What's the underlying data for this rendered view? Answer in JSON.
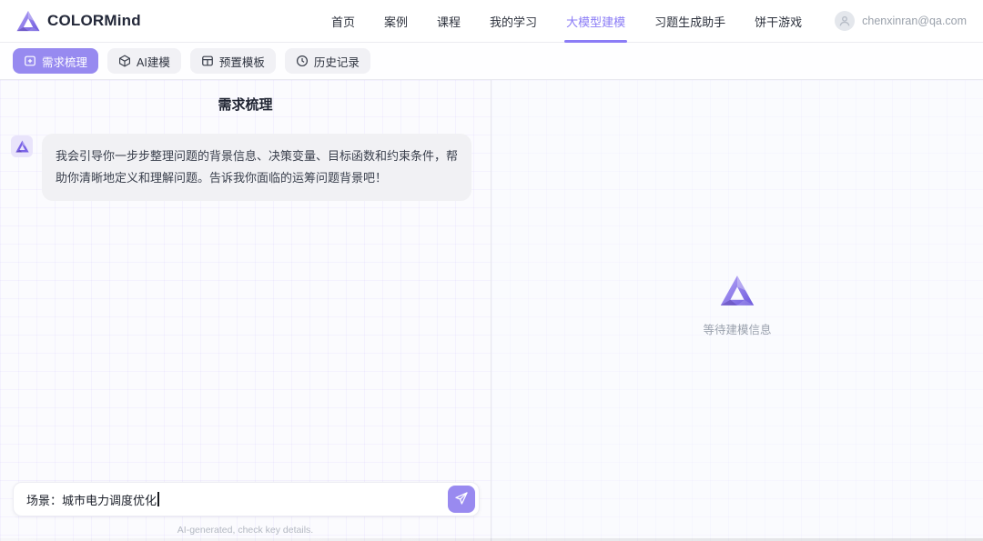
{
  "header": {
    "brand": "COLORMind",
    "nav": [
      {
        "label": "首页",
        "active": false
      },
      {
        "label": "案例",
        "active": false
      },
      {
        "label": "课程",
        "active": false
      },
      {
        "label": "我的学习",
        "active": false
      },
      {
        "label": "大模型建模",
        "active": true
      },
      {
        "label": "习题生成助手",
        "active": false
      },
      {
        "label": "饼干游戏",
        "active": false
      }
    ],
    "user_email": "chenxinran@qa.com",
    "user_avatar_icon": "person-icon"
  },
  "toolbar": {
    "buttons": [
      {
        "label": "需求梳理",
        "icon": "message-plus-icon",
        "active": true
      },
      {
        "label": "AI建模",
        "icon": "cube-icon",
        "active": false
      },
      {
        "label": "预置模板",
        "icon": "template-icon",
        "active": false
      },
      {
        "label": "历史记录",
        "icon": "clock-icon",
        "active": false
      }
    ]
  },
  "left_panel": {
    "title": "需求梳理",
    "messages": [
      {
        "role": "assistant",
        "avatar_icon": "colormind-logo-icon",
        "text": "我会引导你一步步整理问题的背景信息、决策变量、目标函数和约束条件，帮助你清晰地定义和理解问题。告诉我你面临的运筹问题背景吧！"
      }
    ],
    "input": {
      "value": "场景：城市电力调度优化",
      "send_icon": "paper-plane-icon"
    },
    "footer_note": "AI-generated, check key details."
  },
  "right_panel": {
    "empty_icon": "colormind-logo-icon",
    "empty_state_text": "等待建模信息"
  },
  "colors": {
    "accent": "#978af0",
    "nav_active": "#8b7cf6",
    "brand_text": "#232839",
    "bubble_bg": "#f1f1f4",
    "muted_text": "#9aa1ad"
  }
}
